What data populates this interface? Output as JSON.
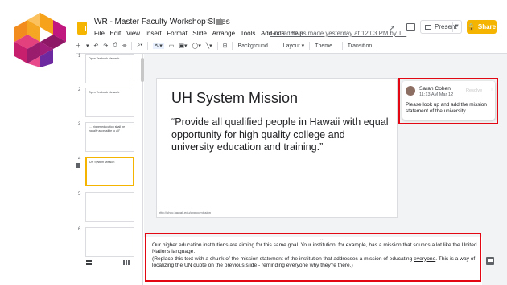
{
  "window": {
    "title": "WR - Master Faculty Workshop Slides",
    "last_edit": "Last edit was made yesterday at 12:03 PM by T..."
  },
  "menu": [
    "File",
    "Edit",
    "View",
    "Insert",
    "Format",
    "Slide",
    "Arrange",
    "Tools",
    "Add-ons",
    "Help"
  ],
  "header_actions": {
    "present_label": "Present",
    "share_label": "Share"
  },
  "toolbar": {
    "background_label": "Background...",
    "layout_label": "Layout ▾",
    "theme_label": "Theme...",
    "transition_label": "Transition..."
  },
  "slides": [
    {
      "num": "1",
      "text": "Open Textbook Network"
    },
    {
      "num": "2",
      "text": "Open Textbook Network"
    },
    {
      "num": "3",
      "text": "“... higher education shall be equally accessible to all”"
    },
    {
      "num": "4",
      "text": "UH System Mission"
    },
    {
      "num": "5",
      "text": ""
    },
    {
      "num": "6",
      "text": ""
    }
  ],
  "current_slide": {
    "title": "UH System Mission",
    "quote": "“Provide all qualified people in Hawaii with equal opportunity for high quality college and university education and training.”",
    "footer_url": "http://uhcc.hawaii.edu/ovpcc/mission"
  },
  "comment": {
    "author": "Sarah Cohen",
    "time": "11:13 AM Mar 12",
    "resolve_label": "Resolve",
    "body": "Please look up and add the mission statement of the university."
  },
  "notes": {
    "line1": "Our higher education institutions are aiming for this same goal. Your institution, for example, has a mission that sounds a lot like the United Nations language.",
    "line2_pre": "(Replace this text with a chunk of the mission statement of the institution that addresses a mission of educating ",
    "line2_em": "everyone",
    "line2_post": ". This is a way of localizing the UN quote on the previous slide - reminding everyone why they're there.)"
  },
  "colors": {
    "accent": "#f4b400",
    "highlight_box": "#e30613"
  }
}
